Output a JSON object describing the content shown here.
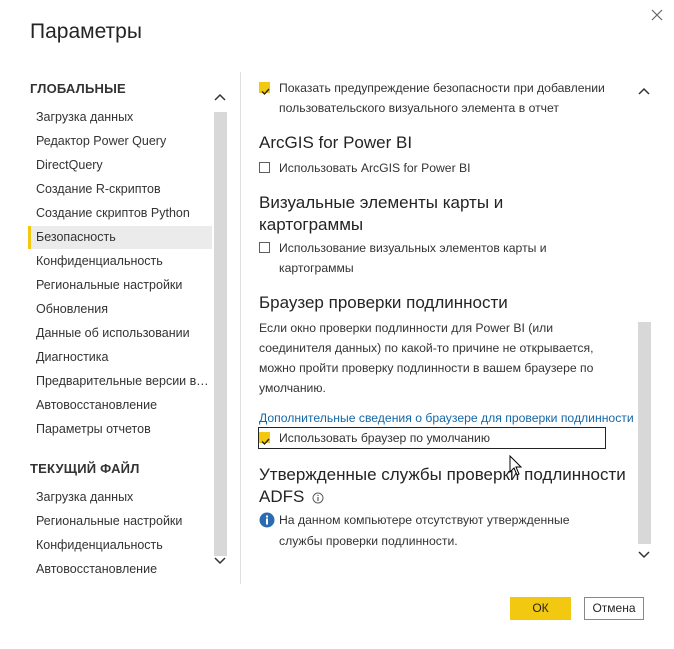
{
  "dialog": {
    "title": "Параметры",
    "ok_label": "ОК",
    "cancel_label": "Отмена"
  },
  "nav": {
    "global_heading": "ГЛОБАЛЬНЫЕ",
    "global_items": [
      "Загрузка данных",
      "Редактор Power Query",
      "DirectQuery",
      "Создание R-скриптов",
      "Создание скриптов Python",
      "Безопасность",
      "Конфиденциальность",
      "Региональные настройки",
      "Обновления",
      "Данные об использовании",
      "Диагностика",
      "Предварительные версии возможностей",
      "Автовосстановление",
      "Параметры отчетов"
    ],
    "selected_item": "Безопасность",
    "current_heading": "ТЕКУЩИЙ ФАЙЛ",
    "current_items": [
      "Загрузка данных",
      "Региональные настройки",
      "Конфиденциальность",
      "Автовосстановление"
    ]
  },
  "content": {
    "visual_warning": {
      "label": "Показать предупреждение безопасности при добавлении пользовательского визуального элемента в отчет",
      "checked": true
    },
    "arcgis": {
      "title": "ArcGIS for Power BI",
      "checkbox_label": "Использовать ArcGIS for Power BI",
      "checked": false
    },
    "maps": {
      "title": "Визуальные элементы карты и картограммы",
      "checkbox_label": "Использование визуальных элементов карты и картограммы",
      "checked": false
    },
    "auth_browser": {
      "title": "Браузер проверки подлинности",
      "description": "Если окно проверки подлинности для Power BI (или соединителя данных) по какой-то причине не открывается, можно пройти проверку подлинности в вашем браузере по умолчанию.",
      "link": "Дополнительные сведения о браузере для проверки подлинности",
      "checkbox_label": "Использовать браузер по умолчанию",
      "checked": true
    },
    "adfs": {
      "title": "Утвержденные службы проверки подлинности ADFS",
      "info_text": "На данном компьютере отсутствуют утвержденные службы проверки подлинности."
    }
  },
  "colors": {
    "accent": "#f2c811",
    "link": "#1468a8",
    "info": "#2b6cb0"
  }
}
